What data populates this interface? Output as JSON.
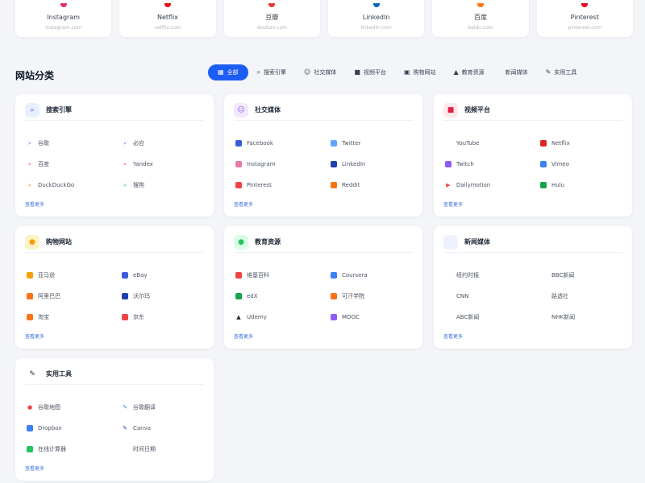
{
  "top_sites": [
    {
      "name": "Instagram",
      "domain": "instagram.com",
      "color": "#e1306c"
    },
    {
      "name": "Netflix",
      "domain": "netflix.com",
      "color": "#e50914"
    },
    {
      "name": "豆瓣",
      "domain": "douban.com",
      "color": "#e53935"
    },
    {
      "name": "LinkedIn",
      "domain": "linkedin.com",
      "color": "#0a66c2"
    },
    {
      "name": "百度",
      "domain": "baidu.com",
      "color": "#f97316"
    },
    {
      "name": "Pinterest",
      "domain": "pinterest.com",
      "color": "#e60023"
    }
  ],
  "section": {
    "title": "网站分类"
  },
  "filters": [
    {
      "label": "全部",
      "icon": "grid-icon",
      "glyph": "▦",
      "active": true
    },
    {
      "label": "搜索引擎",
      "icon": "search-icon",
      "glyph": "⌕",
      "active": false
    },
    {
      "label": "社交媒体",
      "icon": "users-icon",
      "glyph": "☺",
      "active": false
    },
    {
      "label": "视频平台",
      "icon": "video-icon",
      "glyph": "■",
      "active": false
    },
    {
      "label": "购物网站",
      "icon": "bag-icon",
      "glyph": "▣",
      "active": false
    },
    {
      "label": "教育资源",
      "icon": "graduation-icon",
      "glyph": "▲",
      "active": false
    },
    {
      "label": "新闻媒体",
      "icon": "news-icon",
      "glyph": "",
      "active": false
    },
    {
      "label": "实用工具",
      "icon": "wrench-icon",
      "glyph": "✎",
      "active": false
    }
  ],
  "categories": [
    {
      "title": "搜索引擎",
      "icon": "search-icon",
      "glyph": "⌕",
      "icon_bg": "#e8f0fe",
      "icon_color": "#1d5cf5",
      "more": "查看更多",
      "items": [
        {
          "label": "谷歌",
          "icon": "search-icon",
          "glyph": "⌕",
          "color": "#3b82f6"
        },
        {
          "label": "必应",
          "icon": "search-icon",
          "glyph": "⌕",
          "color": "#3b82f6"
        },
        {
          "label": "百度",
          "icon": "search-icon",
          "glyph": "⌕",
          "color": "#ef4444"
        },
        {
          "label": "Yandex",
          "icon": "search-icon",
          "glyph": "⌕",
          "color": "#ef4444"
        },
        {
          "label": "DuckDuckGo",
          "icon": "search-icon",
          "glyph": "⌕",
          "color": "#f97316"
        },
        {
          "label": "搜狗",
          "icon": "search-icon",
          "glyph": "⌕",
          "color": "#22c55e"
        }
      ]
    },
    {
      "title": "社交媒体",
      "icon": "users-icon",
      "glyph": "☺",
      "icon_bg": "#f3e8ff",
      "icon_color": "#8b5cf6",
      "more": "查看更多",
      "items": [
        {
          "label": "Facebook",
          "icon": "facebook-icon",
          "glyph": "",
          "color": "#3b5bdb"
        },
        {
          "label": "Twitter",
          "icon": "twitter-icon",
          "glyph": "",
          "color": "#60a5fa"
        },
        {
          "label": "Instagram",
          "icon": "instagram-icon",
          "glyph": "",
          "color": "#e879a6"
        },
        {
          "label": "LinkedIn",
          "icon": "linkedin-icon",
          "glyph": "",
          "color": "#1e40af"
        },
        {
          "label": "Pinterest",
          "icon": "pinterest-icon",
          "glyph": "",
          "color": "#ef4444"
        },
        {
          "label": "Reddit",
          "icon": "reddit-icon",
          "glyph": "",
          "color": "#f97316"
        }
      ]
    },
    {
      "title": "视频平台",
      "icon": "video-icon",
      "glyph": "■",
      "icon_bg": "#fde8ea",
      "icon_color": "#e11d48",
      "more": "查看更多",
      "items": [
        {
          "label": "YouTube",
          "icon": "youtube-icon",
          "glyph": "",
          "color": "#ffffff"
        },
        {
          "label": "Netflix",
          "icon": "netflix-icon",
          "glyph": "",
          "color": "#dc2626"
        },
        {
          "label": "Twitch",
          "icon": "twitch-icon",
          "glyph": "",
          "color": "#8b5cf6"
        },
        {
          "label": "Vimeo",
          "icon": "vimeo-icon",
          "glyph": "",
          "color": "#3b82f6"
        },
        {
          "label": "Dailymotion",
          "icon": "play-icon",
          "glyph": "▶",
          "color": "#ef4444"
        },
        {
          "label": "Hulu",
          "icon": "hulu-icon",
          "glyph": "",
          "color": "#16a34a"
        }
      ]
    },
    {
      "title": "购物网站",
      "icon": "bag-icon",
      "glyph": "●",
      "icon_bg": "#fef3c7",
      "icon_color": "#f59e0b",
      "more": "查看更多",
      "items": [
        {
          "label": "亚马逊",
          "icon": "amazon-icon",
          "glyph": "",
          "color": "#f59e0b"
        },
        {
          "label": "eBay",
          "icon": "ebay-icon",
          "glyph": "",
          "color": "#3b5bdb"
        },
        {
          "label": "阿里巴巴",
          "icon": "alibaba-icon",
          "glyph": "",
          "color": "#f97316"
        },
        {
          "label": "沃尔玛",
          "icon": "walmart-icon",
          "glyph": "",
          "color": "#1e40af"
        },
        {
          "label": "淘宝",
          "icon": "taobao-icon",
          "glyph": "",
          "color": "#f97316"
        },
        {
          "label": "京东",
          "icon": "jd-icon",
          "glyph": "",
          "color": "#ef4444"
        }
      ]
    },
    {
      "title": "教育资源",
      "icon": "graduation-icon",
      "glyph": "●",
      "icon_bg": "#dcfce7",
      "icon_color": "#22c55e",
      "more": "查看更多",
      "items": [
        {
          "label": "维基百科",
          "icon": "wikipedia-icon",
          "glyph": "",
          "color": "#ef4444"
        },
        {
          "label": "Coursera",
          "icon": "coursera-icon",
          "glyph": "",
          "color": "#3b82f6"
        },
        {
          "label": "edX",
          "icon": "edx-icon",
          "glyph": "",
          "color": "#16a34a"
        },
        {
          "label": "可汗学院",
          "icon": "khan-icon",
          "glyph": "",
          "color": "#f97316"
        },
        {
          "label": "Udemy",
          "icon": "graduation-icon",
          "glyph": "▲",
          "color": "#1f2937"
        },
        {
          "label": "MOOC",
          "icon": "mooc-icon",
          "glyph": "",
          "color": "#8b5cf6"
        }
      ]
    },
    {
      "title": "新闻媒体",
      "icon": "news-icon",
      "glyph": "",
      "icon_bg": "#eef2ff",
      "icon_color": "#6366f1",
      "more": "查看更多",
      "items": [
        {
          "label": "纽约时报",
          "icon": "nyt-icon",
          "glyph": "",
          "color": "#ffffff"
        },
        {
          "label": "BBC新闻",
          "icon": "bbc-icon",
          "glyph": "",
          "color": "#ffffff"
        },
        {
          "label": "CNN",
          "icon": "cnn-icon",
          "glyph": "",
          "color": "#ffffff"
        },
        {
          "label": "路透社",
          "icon": "reuters-icon",
          "glyph": "",
          "color": "#ffffff"
        },
        {
          "label": "ABC新闻",
          "icon": "abc-icon",
          "glyph": "",
          "color": "#ffffff"
        },
        {
          "label": "NHK新闻",
          "icon": "nhk-icon",
          "glyph": "",
          "color": "#ffffff"
        }
      ]
    },
    {
      "title": "实用工具",
      "icon": "wrench-icon",
      "glyph": "✎",
      "icon_bg": "#ffffff",
      "icon_color": "#1f2937",
      "more": "查看更多",
      "items": [
        {
          "label": "谷歌地图",
          "icon": "map-pin-icon",
          "glyph": "●",
          "color": "#ef4444"
        },
        {
          "label": "谷歌翻译",
          "icon": "translate-icon",
          "glyph": "✎",
          "color": "#3b82f6"
        },
        {
          "label": "Dropbox",
          "icon": "cloud-icon",
          "glyph": "",
          "color": "#3b82f6"
        },
        {
          "label": "Canva",
          "icon": "brush-icon",
          "glyph": "✎",
          "color": "#1e40af"
        },
        {
          "label": "在线计算器",
          "icon": "calculator-icon",
          "glyph": "",
          "color": "#22c55e"
        },
        {
          "label": "时间日期",
          "icon": "clock-icon",
          "glyph": "",
          "color": "#ffffff"
        }
      ]
    }
  ]
}
